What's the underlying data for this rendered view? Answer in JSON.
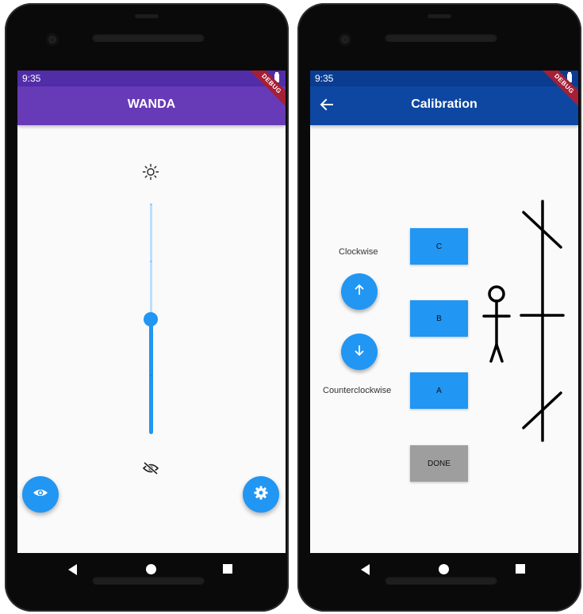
{
  "left_phone": {
    "status_time": "9:35",
    "debug_label": "DEBUG",
    "app_title": "WANDA",
    "colors": {
      "app_bar": "#673ab7",
      "accent": "#2196f3"
    },
    "slider": {
      "value_fraction": 0.5
    },
    "icons": [
      "brightness-icon",
      "visibility-off-icon",
      "eye-icon",
      "gear-icon"
    ]
  },
  "right_phone": {
    "status_time": "9:35",
    "debug_label": "DEBUG",
    "app_title": "Calibration",
    "colors": {
      "app_bar": "#0d47a1",
      "accent": "#2196f3",
      "done_button": "#9e9e9e"
    },
    "labels": {
      "clockwise": "Clockwise",
      "counterclockwise": "Counterclockwise"
    },
    "buttons": {
      "c": "C",
      "b": "B",
      "a": "A",
      "done": "DONE"
    },
    "icons": [
      "back-arrow-icon",
      "arrow-up-icon",
      "arrow-down-icon"
    ]
  },
  "navbar": {
    "icons": [
      "nav-back-icon",
      "nav-home-icon",
      "nav-recents-icon"
    ]
  }
}
